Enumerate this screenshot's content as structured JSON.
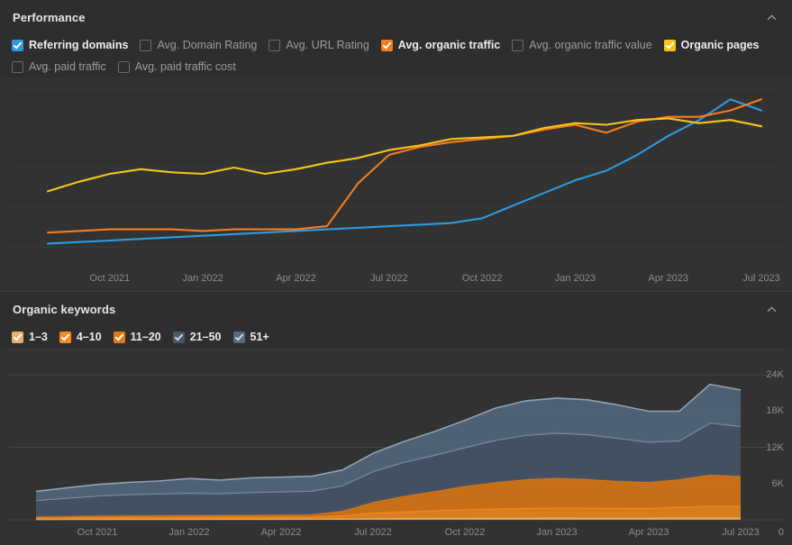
{
  "performance": {
    "title": "Performance",
    "collapse_icon": "chevron-up-icon",
    "metrics": [
      {
        "label": "Referring domains",
        "checked": true,
        "color": "#2e9ae0"
      },
      {
        "label": "Avg. Domain Rating",
        "checked": false,
        "color": ""
      },
      {
        "label": "Avg. URL Rating",
        "checked": false,
        "color": ""
      },
      {
        "label": "Avg. organic traffic",
        "checked": true,
        "color": "#f57c1f"
      },
      {
        "label": "Avg. organic traffic value",
        "checked": false,
        "color": ""
      },
      {
        "label": "Organic pages",
        "checked": true,
        "color": "#f5c518"
      },
      {
        "label": "Avg. paid traffic",
        "checked": false,
        "color": ""
      },
      {
        "label": "Avg. paid traffic cost",
        "checked": false,
        "color": ""
      }
    ]
  },
  "organic_keywords": {
    "title": "Organic keywords",
    "collapse_icon": "chevron-up-icon",
    "buckets": [
      {
        "label": "1–3",
        "checked": true,
        "color": "#e8b06a"
      },
      {
        "label": "4–10",
        "checked": true,
        "color": "#f58b1f"
      },
      {
        "label": "11–20",
        "checked": true,
        "color": "#e07a14"
      },
      {
        "label": "21–50",
        "checked": true,
        "color": "#46566b"
      },
      {
        "label": "51+",
        "checked": true,
        "color": "#55687f"
      }
    ]
  },
  "chart_data": [
    {
      "type": "line",
      "title": "Performance",
      "xlabel": "",
      "ylabel": "",
      "grid": true,
      "legend_position": "top",
      "x": [
        "Aug 2021",
        "Sep 2021",
        "Oct 2021",
        "Nov 2021",
        "Dec 2021",
        "Jan 2022",
        "Feb 2022",
        "Mar 2022",
        "Apr 2022",
        "May 2022",
        "Jun 2022",
        "Jul 2022",
        "Aug 2022",
        "Sep 2022",
        "Oct 2022",
        "Nov 2022",
        "Dec 2022",
        "Jan 2023",
        "Feb 2023",
        "Mar 2023",
        "Apr 2023",
        "May 2023",
        "Jun 2023",
        "Jul 2023"
      ],
      "tick_labels": [
        "Oct 2021",
        "Jan 2022",
        "Apr 2022",
        "Jul 2022",
        "Oct 2022",
        "Jan 2023",
        "Apr 2023",
        "Jul 2023"
      ],
      "series": [
        {
          "name": "Referring domains",
          "color": "#2e9ae0",
          "values": [
            2,
            3,
            4,
            5,
            6,
            7,
            8,
            9,
            10,
            11,
            12,
            13,
            14,
            15,
            18,
            26,
            34,
            42,
            48,
            58,
            70,
            80,
            93,
            86
          ]
        },
        {
          "name": "Avg. organic traffic",
          "color": "#f57c1f",
          "values": [
            9,
            10,
            11,
            11,
            11,
            10,
            11,
            11,
            11,
            13,
            40,
            58,
            63,
            66,
            68,
            70,
            74,
            77,
            72,
            79,
            82,
            82,
            86,
            93
          ]
        },
        {
          "name": "Organic pages",
          "color": "#f5c518",
          "values": [
            35,
            41,
            46,
            49,
            47,
            46,
            50,
            46,
            49,
            53,
            56,
            61,
            64,
            68,
            69,
            70,
            75,
            78,
            77,
            80,
            81,
            78,
            80,
            76
          ]
        }
      ]
    },
    {
      "type": "area",
      "stacked": true,
      "title": "Organic keywords",
      "xlabel": "",
      "ylabel": "",
      "grid": true,
      "legend_position": "top",
      "ylim": [
        0,
        27000
      ],
      "yticks": [
        0,
        6000,
        12000,
        18000,
        24000
      ],
      "ytick_labels": [
        "0",
        "6K",
        "12K",
        "18K",
        "24K"
      ],
      "x": [
        "Aug 2021",
        "Sep 2021",
        "Oct 2021",
        "Nov 2021",
        "Dec 2021",
        "Jan 2022",
        "Feb 2022",
        "Mar 2022",
        "Apr 2022",
        "May 2022",
        "Jun 2022",
        "Jul 2022",
        "Aug 2022",
        "Sep 2022",
        "Oct 2022",
        "Nov 2022",
        "Dec 2022",
        "Jan 2023",
        "Feb 2023",
        "Mar 2023",
        "Apr 2023",
        "May 2023",
        "Jun 2023",
        "Jul 2023"
      ],
      "tick_labels": [
        "Oct 2021",
        "Jan 2022",
        "Apr 2022",
        "Jul 2022",
        "Oct 2022",
        "Jan 2023",
        "Apr 2023",
        "Jul 2023"
      ],
      "series": [
        {
          "name": "1–3",
          "color": "#e8b06a",
          "values": [
            60,
            70,
            80,
            85,
            90,
            95,
            100,
            105,
            110,
            120,
            150,
            200,
            230,
            250,
            270,
            290,
            300,
            310,
            300,
            300,
            300,
            330,
            340,
            340
          ]
        },
        {
          "name": "4–10",
          "color": "#f58b1f",
          "values": [
            200,
            230,
            260,
            270,
            280,
            290,
            300,
            310,
            320,
            340,
            500,
            900,
            1100,
            1250,
            1400,
            1500,
            1600,
            1650,
            1620,
            1600,
            1580,
            1750,
            1900,
            1850
          ]
        },
        {
          "name": "11–20",
          "color": "#e07a14",
          "values": [
            250,
            280,
            310,
            330,
            340,
            350,
            360,
            370,
            380,
            400,
            800,
            1800,
            2600,
            3200,
            3900,
            4400,
            4800,
            4950,
            4800,
            4500,
            4350,
            4600,
            5200,
            5000
          ]
        },
        {
          "name": "21–50",
          "color": "#46566b",
          "values": [
            2700,
            3000,
            3300,
            3500,
            3600,
            3700,
            3600,
            3750,
            3850,
            3900,
            4200,
            5100,
            5600,
            6000,
            6400,
            7000,
            7300,
            7450,
            7400,
            7100,
            6650,
            6400,
            8600,
            8300
          ]
        },
        {
          "name": "51+",
          "color": "#55687f",
          "values": [
            1500,
            1700,
            1900,
            2000,
            2100,
            2400,
            2200,
            2400,
            2400,
            2450,
            2600,
            3000,
            3400,
            3900,
            4500,
            5300,
            5700,
            5800,
            5750,
            5500,
            5100,
            4900,
            6400,
            6000
          ]
        }
      ]
    }
  ]
}
